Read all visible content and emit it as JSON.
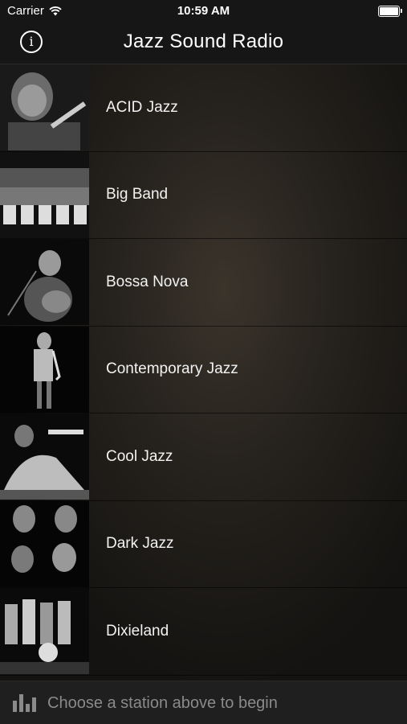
{
  "status_bar": {
    "carrier": "Carrier",
    "time": "10:59 AM"
  },
  "nav": {
    "title": "Jazz Sound Radio",
    "info_icon": "info-icon"
  },
  "stations": [
    {
      "label": "ACID Jazz"
    },
    {
      "label": "Big Band"
    },
    {
      "label": "Bossa Nova"
    },
    {
      "label": "Contemporary Jazz"
    },
    {
      "label": "Cool Jazz"
    },
    {
      "label": "Dark Jazz"
    },
    {
      "label": "Dixieland"
    }
  ],
  "player": {
    "icon": "equalizer-icon",
    "message": "Choose a station above to begin"
  }
}
